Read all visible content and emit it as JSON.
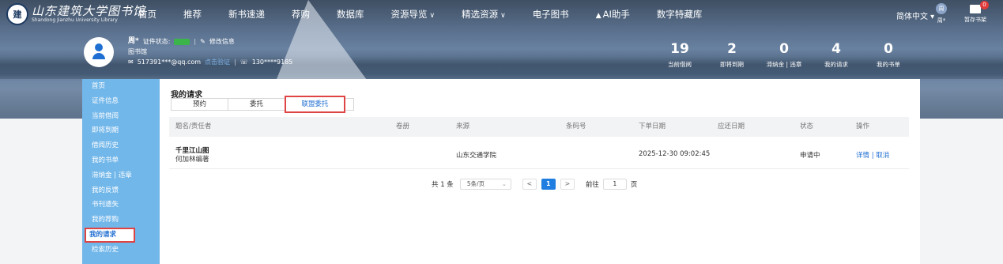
{
  "header": {
    "logo": {
      "text_cn": "山东建筑大学图书馆",
      "text_en": "Shandong Jianzhu University Library",
      "seal_char": "建"
    },
    "nav": [
      {
        "label": "首页",
        "has_dropdown": false
      },
      {
        "label": "推荐",
        "has_dropdown": false
      },
      {
        "label": "新书速递",
        "has_dropdown": false
      },
      {
        "label": "荐购",
        "has_dropdown": false
      },
      {
        "label": "数据库",
        "has_dropdown": false
      },
      {
        "label": "资源导览",
        "has_dropdown": true
      },
      {
        "label": "精选资源",
        "has_dropdown": true
      },
      {
        "label": "电子图书",
        "has_dropdown": false
      },
      {
        "label": "AI助手",
        "has_dropdown": false,
        "icon": "ai-icon"
      },
      {
        "label": "数字特藏库",
        "has_dropdown": false
      }
    ],
    "chevron": "∨",
    "language": "简体中文 ▾",
    "user": {
      "initial": "周",
      "name": "周*"
    },
    "shelf": {
      "label": "暂存书架",
      "badge": "0"
    }
  },
  "profile": {
    "name": "周*",
    "status_label": "证件状态:",
    "status_value": "",
    "edit_label": "修改信息",
    "role": "图书馆",
    "email": "517391***@qq.com",
    "verify_label": "点击验证",
    "phone": "130****9185"
  },
  "stats": [
    {
      "value": "19",
      "label": "当前借阅"
    },
    {
      "value": "2",
      "label": "即将到期"
    },
    {
      "value": "0",
      "label": "滞纳金 | 违章"
    },
    {
      "value": "4",
      "label": "我的请求"
    },
    {
      "value": "0",
      "label": "我的书单"
    }
  ],
  "sidebar": {
    "items": [
      {
        "label": "首页",
        "active": false
      },
      {
        "label": "证件信息",
        "active": false
      },
      {
        "label": "当前借阅",
        "active": false
      },
      {
        "label": "即将到期",
        "active": false
      },
      {
        "label": "借阅历史",
        "active": false
      },
      {
        "label": "我的书单",
        "active": false
      },
      {
        "label": "滞纳金 | 违章",
        "active": false
      },
      {
        "label": "我的反馈",
        "active": false
      },
      {
        "label": "书刊遗失",
        "active": false
      },
      {
        "label": "我的荐购",
        "active": false
      },
      {
        "label": "我的请求",
        "active": true
      },
      {
        "label": "检索历史",
        "active": false
      }
    ]
  },
  "main": {
    "title": "我的请求",
    "tabs": [
      {
        "label": "预约",
        "active": false
      },
      {
        "label": "委托",
        "active": false
      },
      {
        "label": "联盟委托",
        "active": true
      }
    ],
    "columns": [
      "题名/责任者",
      "卷册",
      "来源",
      "条码号",
      "下单日期",
      "应还日期",
      "状态",
      "操作"
    ],
    "rows": [
      {
        "title": "千里江山图",
        "author": "何加林编著",
        "volume": "",
        "source": "山东交通学院",
        "barcode": "",
        "order_date": "2025-12-30 09:02:45",
        "due_date": "",
        "status": "申请中",
        "actions": "详情 | 取消"
      }
    ],
    "pagination": {
      "total": "共 1 条",
      "page_size": "5条/页",
      "prev": "<",
      "current": "1",
      "next": ">",
      "goto_label": "前往",
      "goto_value": "1",
      "page_suffix": "页"
    }
  }
}
